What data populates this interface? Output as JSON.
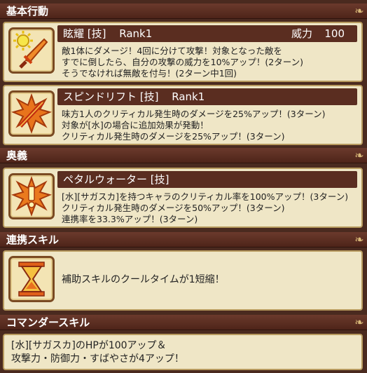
{
  "sections": {
    "basic": "基本行動",
    "ougi": "奥義",
    "renkei": "連携スキル",
    "commander": "コマンダースキル"
  },
  "skills": [
    {
      "name": "眩耀 [技]",
      "rank": "Rank1",
      "power_label": "威力",
      "power_value": "100",
      "lines": [
        "敵1体にダメージ！4回に分けて攻撃！対象となった敵を",
        "すでに倒したら、自分の攻撃の威力を10%アップ！(2ターン)",
        "そうでなければ無敵を付与！(2ターン中1回)"
      ],
      "icon": "sun-sword-icon"
    },
    {
      "name": "スピンドリフト [技]",
      "rank": "Rank1",
      "lines": [
        "味方1人のクリティカル発生時のダメージを25%アップ！(3ターン)",
        "対象が[水]の場合に追加効果が発動！",
        "クリティカル発生時のダメージを25%アップ！(3ターン)"
      ],
      "icon": "burst-sword-icon"
    },
    {
      "name": "ペタルウォーター [技]",
      "lines": [
        "[水][サガスカ]を持つキャラのクリティカル率を100%アップ！(3ターン)",
        "クリティカル発生時のダメージを50%アップ！(3ターン)",
        "連携率を33.3%アップ！(3ターン)"
      ],
      "icon": "exclamation-burst-icon"
    }
  ],
  "renkei_text": "補助スキルのクールタイムが1短縮！",
  "renkei_icon": "hourglass-icon",
  "commander_lines": [
    "[水][サガスカ]のHPが100アップ＆",
    "攻撃力・防御力・すばやさが4アップ！"
  ]
}
